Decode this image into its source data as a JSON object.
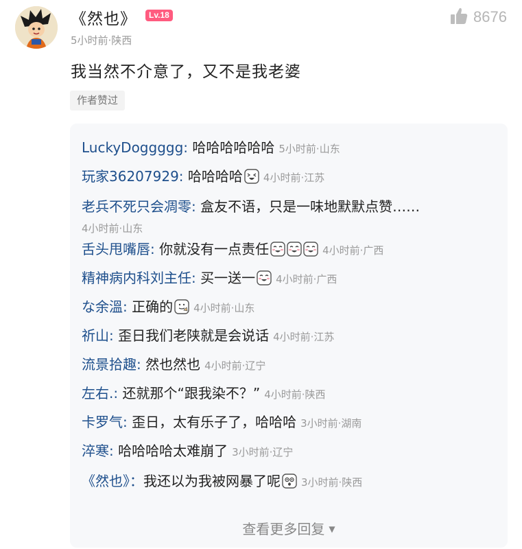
{
  "post": {
    "author": "《然也》",
    "level": "Lv.18",
    "likes": "8676",
    "meta": "5小时前·陕西",
    "content": "我当然不介意了，又不是我老婆",
    "author_liked_tag": "作者赞过"
  },
  "replies": [
    {
      "user": "LuckyDoggggg",
      "sep": ": ",
      "text": "哈哈哈哈哈哈",
      "emoji": [],
      "time": "5小时前·山东"
    },
    {
      "user": "玩家36207929",
      "sep": ": ",
      "text": "哈哈哈哈",
      "emoji": [
        "laugh-emoji"
      ],
      "time": "4小时前·江苏"
    },
    {
      "user": "老兵不死只会凋零",
      "sep": ": ",
      "text": "盒友不语，只是一味地默默点赞……",
      "emoji": [],
      "time": "4小时前·山东"
    },
    {
      "user": "舌头甩嘴唇",
      "sep": ": ",
      "text": "你就没有一点责任",
      "emoji": [
        "grin-emoji",
        "grin-emoji",
        "grin-emoji"
      ],
      "time": "4小时前·广西"
    },
    {
      "user": "精神病内科刘主任",
      "sep": ": ",
      "text": "买一送一",
      "emoji": [
        "grin-emoji"
      ],
      "time": "4小时前·广西"
    },
    {
      "user": "な余溫",
      "sep": ": ",
      "text": "正确的",
      "emoji": [
        "thumb-emoji"
      ],
      "time": "4小时前·山东"
    },
    {
      "user": "祈山",
      "sep": ": ",
      "text": "歪日我们老陕就是会说话",
      "emoji": [],
      "time": "4小时前·江苏"
    },
    {
      "user": "流景拾趣",
      "sep": ": ",
      "text": "然也然也",
      "emoji": [],
      "time": "4小时前·辽宁"
    },
    {
      "user": "左右.",
      "sep": ": ",
      "text": "还就那个“跟我染不？”",
      "emoji": [],
      "time": "4小时前·陕西"
    },
    {
      "user": "卡罗气",
      "sep": ": ",
      "text": "歪日，太有乐子了，哈哈哈",
      "emoji": [],
      "time": "3小时前·湖南"
    },
    {
      "user": "淬寒",
      "sep": ": ",
      "text": "哈哈哈哈太难崩了",
      "emoji": [],
      "time": "3小时前·辽宁"
    },
    {
      "user": "《然也》",
      "sep": "：",
      "text": "我还以为我被网暴了呢",
      "emoji": [
        "shocked-emoji"
      ],
      "time": "3小时前·陕西"
    }
  ],
  "more_replies_label": "查看更多回复",
  "colors": {
    "username": "#1e4f8c",
    "badge": "#ff5b7f",
    "muted": "#999999"
  }
}
